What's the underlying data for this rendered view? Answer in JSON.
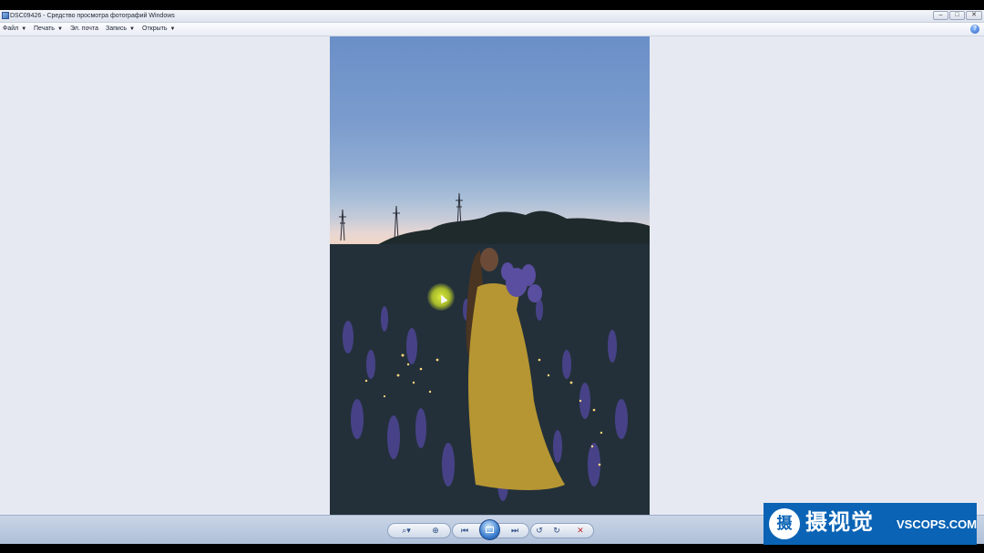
{
  "window": {
    "title": "DSC09426 - Средство просмотра фотографий Windows",
    "controls": {
      "minimize": "–",
      "maximize": "□",
      "close": "✕"
    }
  },
  "menu": {
    "items": [
      {
        "label": "Файл",
        "caret": "▼"
      },
      {
        "label": "Печать",
        "caret": "▼"
      },
      {
        "label": "Эл. почта"
      },
      {
        "label": "Запись",
        "caret": "▼"
      },
      {
        "label": "Открыть",
        "caret": "▼"
      }
    ],
    "help": "?"
  },
  "controls": {
    "zoom": "⌕▾",
    "fit": "⊕",
    "previous": "⏮",
    "next": "⏭",
    "rotate_left": "↺",
    "rotate_right": "↻",
    "delete": "✕"
  },
  "watermark": {
    "logo_char": "摄",
    "brand_cn": "摄视觉",
    "brand_en": "VSCOPS.COM"
  },
  "colors": {
    "delete": "#c0282d",
    "accent": "#2b4d85",
    "watermark_bg": "#0a63b5"
  }
}
